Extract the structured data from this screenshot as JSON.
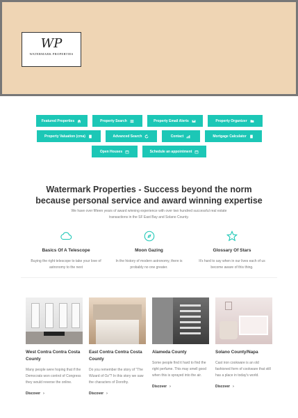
{
  "brand": {
    "monogram": "WP",
    "name": "WATERMARK PROPERTIES"
  },
  "nav": {
    "rows": [
      [
        {
          "label": "Featured Properties",
          "icon": "home-icon"
        },
        {
          "label": "Property Search",
          "icon": "list-icon"
        },
        {
          "label": "Property Email Alerts",
          "icon": "mail-icon"
        },
        {
          "label": "Property Organizer",
          "icon": "folder-icon"
        }
      ],
      [
        {
          "label": "Property Valuation (cma)",
          "icon": "calculator-icon"
        },
        {
          "label": "Advanced Search",
          "icon": "refresh-icon"
        },
        {
          "label": "Contact",
          "icon": "chart-icon"
        },
        {
          "label": "Mortgage Calculator",
          "icon": "calculator-icon"
        }
      ],
      [
        {
          "label": "Open Houses",
          "icon": "calendar-icon"
        },
        {
          "label": "Schedule an appointment",
          "icon": "calendar-icon"
        }
      ]
    ]
  },
  "headline": "Watermark Properties -  Success beyond  the norm because personal service and award winning expertise",
  "intro": "We have over fifteen years of award winning experience with over two hundred successful real estate transactions in the SF East Bay and Solano County.",
  "features": [
    {
      "title": "Basics Of A Telescope",
      "text": "Buying the right telescope to take your love of astronomy to the next",
      "icon": "cloud-icon"
    },
    {
      "title": "Moon Gazing",
      "text": "In the history of modern astronomy, there is probably no one greater.",
      "icon": "compass-icon"
    },
    {
      "title": "Glossary Of Stars",
      "text": "It's hard to say when in our lives each of us become aware of this thing.",
      "icon": "star-icon"
    }
  ],
  "cards": [
    {
      "title": "West Contra  Contra Costa County",
      "text": "Many people were hoping that if the Democrats won control of Congress they would reverse the online.",
      "link": "Discover"
    },
    {
      "title": "East Contra Contra Costa County",
      "text": "Do you remember the story of \"The Wizard of Oz\"? In this story we saw the characters of Dorothy.",
      "link": "Discover"
    },
    {
      "title": "Alameda County",
      "text": "Some people find it hard to find the right perfume. This may smell good when this is sprayed into the air.",
      "link": "Discover"
    },
    {
      "title": "Solano County/Napa",
      "text": "Cast iron cookware is an old fashioned form of cookware that still has a place in today's world.",
      "link": "Discover"
    }
  ],
  "colors": {
    "accent": "#1cc7b6",
    "hero_bg": "#efd5b4"
  }
}
